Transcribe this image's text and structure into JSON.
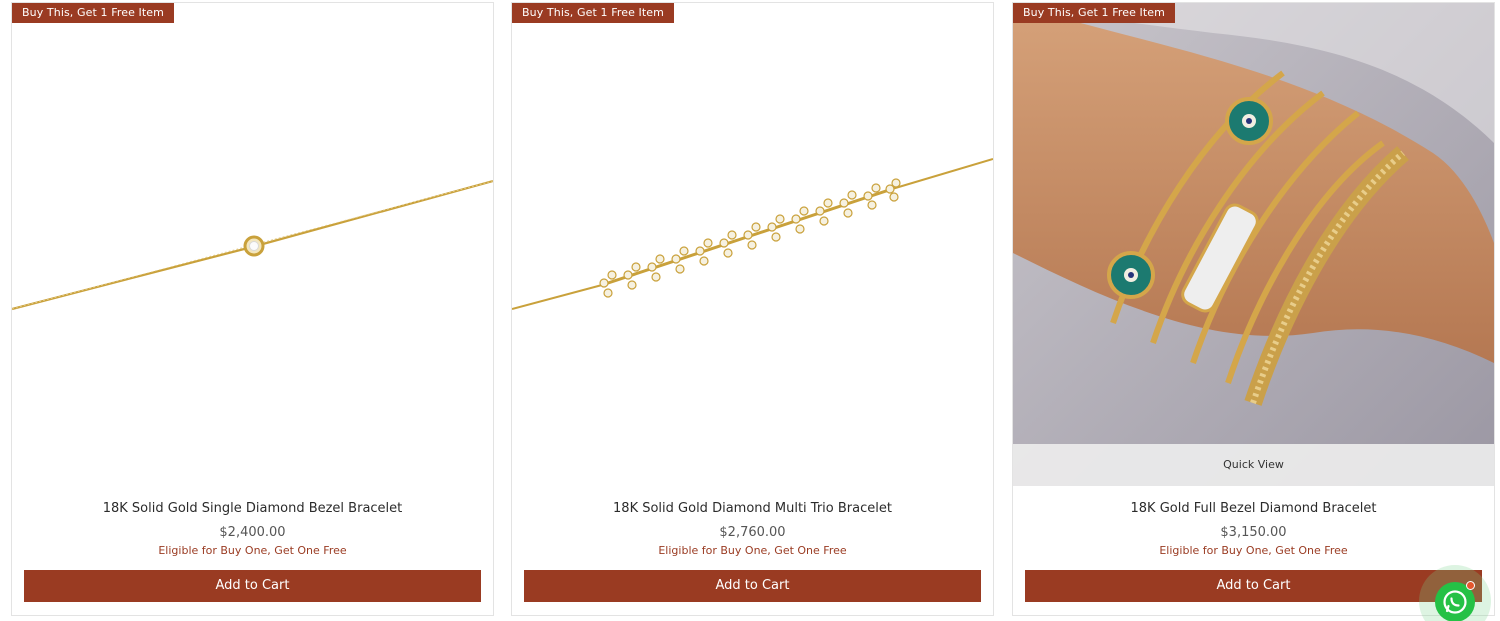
{
  "products": [
    {
      "badge": "Buy This, Get 1 Free Item",
      "title": "18K Solid Gold Single Diamond Bezel Bracelet",
      "price": "$2,400.00",
      "promo": "Eligible for Buy One, Get One Free",
      "cart_label": "Add to Cart"
    },
    {
      "badge": "Buy This, Get 1 Free Item",
      "title": "18K Solid Gold Diamond Multi Trio Bracelet",
      "price": "$2,760.00",
      "promo": "Eligible for Buy One, Get One Free",
      "cart_label": "Add to Cart"
    },
    {
      "badge": "Buy This, Get 1 Free Item",
      "title": "18K Gold Full Bezel Diamond Bracelet",
      "price": "$3,150.00",
      "promo": "Eligible for Buy One, Get One Free",
      "cart_label": "Add to Cart",
      "quick_view": "Quick View"
    }
  ],
  "colors": {
    "accent": "#9a3b22",
    "gold": "#c9a13b",
    "whatsapp": "#25c146"
  },
  "chat_widget": {
    "icon": "whatsapp-icon"
  }
}
